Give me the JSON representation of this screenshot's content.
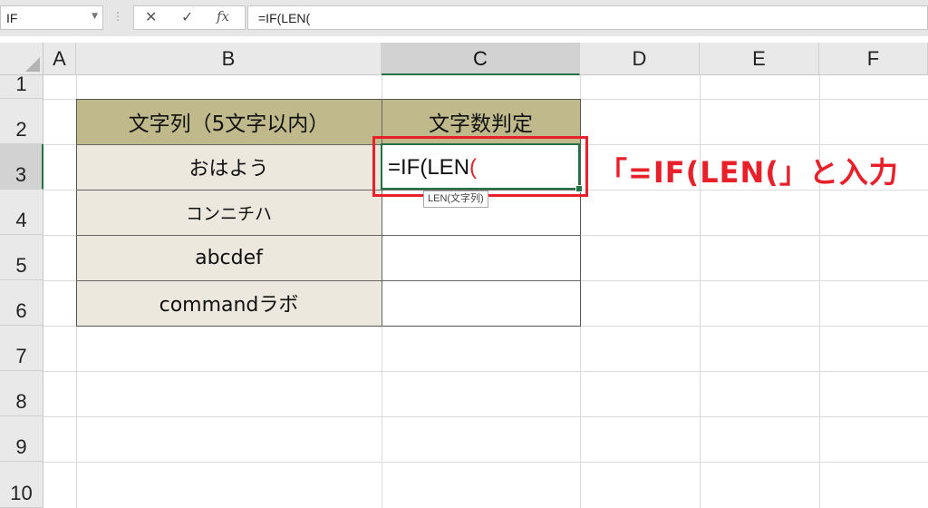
{
  "formula_bar": {
    "name_box": "IF",
    "cancel_icon": "✕",
    "enter_icon": "✓",
    "fx_label": "fx",
    "formula": "=IF(LEN("
  },
  "columns": [
    "A",
    "B",
    "C",
    "D",
    "E",
    "F"
  ],
  "selected_column": "C",
  "rows": [
    "1",
    "2",
    "3",
    "4",
    "5",
    "6",
    "7",
    "8",
    "9",
    "10"
  ],
  "selected_row": "3",
  "table": {
    "header_b": "文字列（5文字以内）",
    "header_c": "文字数判定",
    "values_b": [
      "おはよう",
      "コンニチハ",
      "abcdef",
      "commandラボ"
    ]
  },
  "active_cell": {
    "text_main": "=IF(LEN",
    "text_paren": "("
  },
  "tooltip": "LEN(文字列)",
  "annotation": "「=IF(LEN(」と入力",
  "colors": {
    "header_fill": "#bfb98b",
    "body_fill": "#ece8de",
    "accent_green": "#217346",
    "highlight_red": "#e8202a"
  }
}
